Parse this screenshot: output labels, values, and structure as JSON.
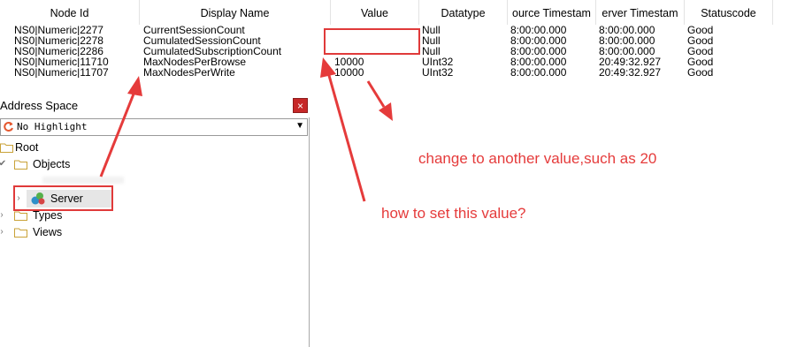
{
  "grid": {
    "columns": [
      "Node Id",
      "Display Name",
      "Value",
      "Datatype",
      "ource Timestam",
      "erver Timestam",
      "Statuscode"
    ],
    "rows": [
      {
        "node_id": "NS0|Numeric|2277",
        "display_name": "CurrentSessionCount",
        "value": "",
        "datatype": "Null",
        "source_ts": "8:00:00.000",
        "server_ts": "8:00:00.000",
        "status": "Good"
      },
      {
        "node_id": "NS0|Numeric|2278",
        "display_name": "CumulatedSessionCount",
        "value": "",
        "datatype": "Null",
        "source_ts": "8:00:00.000",
        "server_ts": "8:00:00.000",
        "status": "Good"
      },
      {
        "node_id": "NS0|Numeric|2286",
        "display_name": "CumulatedSubscriptionCount",
        "value": "",
        "datatype": "Null",
        "source_ts": "8:00:00.000",
        "server_ts": "8:00:00.000",
        "status": "Good"
      },
      {
        "node_id": "NS0|Numeric|11710",
        "display_name": "MaxNodesPerBrowse",
        "value": "10000",
        "datatype": "UInt32",
        "source_ts": "8:00:00.000",
        "server_ts": "20:49:32.927",
        "status": "Good"
      },
      {
        "node_id": "NS0|Numeric|11707",
        "display_name": "MaxNodesPerWrite",
        "value": "10000",
        "datatype": "UInt32",
        "source_ts": "8:00:00.000",
        "server_ts": "20:49:32.927",
        "status": "Good"
      }
    ]
  },
  "address_space": {
    "title": "Address Space",
    "close_label": "×",
    "highlight_select": "No Highlight",
    "tree": {
      "root": "Root",
      "objects": "Objects",
      "server": "Server",
      "types": "Types",
      "views": "Views"
    }
  },
  "annotations": {
    "change_value": "change to another value,such as 20",
    "how_to_set": "how to set this value?"
  },
  "colors": {
    "annotation_red": "#e53b3b",
    "close_button": "#c62828",
    "folder": "#e8c25a"
  }
}
